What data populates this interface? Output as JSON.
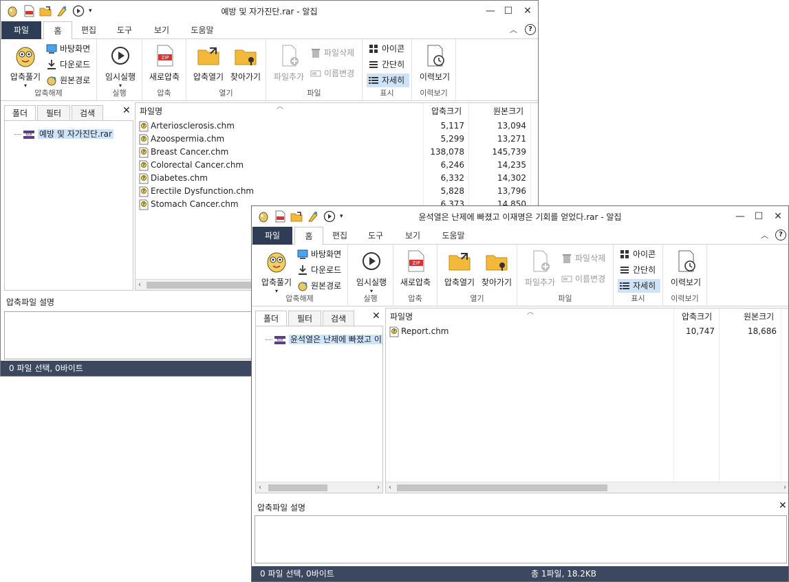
{
  "windows": [
    {
      "title": "예방 및 자가진단.rar - 알집",
      "tabs": [
        "파일",
        "홈",
        "편집",
        "도구",
        "보기",
        "도움말"
      ],
      "ribbon": {
        "extract_big": "압축풀기",
        "desktop": "바탕화면",
        "download": "다운로드",
        "original_path": "원본경로",
        "group_extract": "압축해제",
        "run_temp": "임시실행",
        "group_run": "실행",
        "new_archive": "새로압축",
        "group_compress": "압축",
        "open_archive": "압축열기",
        "find": "찾아가기",
        "group_open": "열기",
        "add_file": "파일추가",
        "delete_file": "파일삭제",
        "rename": "이름변경",
        "group_file": "파일",
        "icon_view": "아이콘",
        "simple_view": "간단히",
        "detail_view": "자세히",
        "group_view": "표시",
        "history": "이력보기",
        "group_history": "이력보기"
      },
      "pane_tabs": [
        "폴더",
        "필터",
        "검색"
      ],
      "tree_node": "예방 및 자가진단.rar",
      "columns": {
        "name": "파일명",
        "compressed": "압축크기",
        "original": "원본크기"
      },
      "files": [
        {
          "name": "Arteriosclerosis.chm",
          "compressed": "5,117",
          "original": "13,094"
        },
        {
          "name": "Azoospermia.chm",
          "compressed": "5,299",
          "original": "13,271"
        },
        {
          "name": "Breast Cancer.chm",
          "compressed": "138,078",
          "original": "145,739"
        },
        {
          "name": "Colorectal Cancer.chm",
          "compressed": "6,246",
          "original": "14,235"
        },
        {
          "name": "Diabetes.chm",
          "compressed": "6,332",
          "original": "14,302"
        },
        {
          "name": "Erectile Dysfunction.chm",
          "compressed": "5,828",
          "original": "13,796"
        },
        {
          "name": "Stomach Cancer.chm",
          "compressed": "6,373",
          "original": "14,850"
        }
      ],
      "desc_label": "압축파일 설명",
      "status_left": "0 파일 선택,  0바이트",
      "status_right": ""
    },
    {
      "title": "윤석열은 난제에 빠졌고 이재명은 기회를 얻었다.rar - 알집",
      "tabs": [
        "파일",
        "홈",
        "편집",
        "도구",
        "보기",
        "도움말"
      ],
      "ribbon": {
        "extract_big": "압축풀기",
        "desktop": "바탕화면",
        "download": "다운로드",
        "original_path": "원본경로",
        "group_extract": "압축해제",
        "run_temp": "임시실행",
        "group_run": "실행",
        "new_archive": "새로압축",
        "group_compress": "압축",
        "open_archive": "압축열기",
        "find": "찾아가기",
        "group_open": "열기",
        "add_file": "파일추가",
        "delete_file": "파일삭제",
        "rename": "이름변경",
        "group_file": "파일",
        "icon_view": "아이콘",
        "simple_view": "간단히",
        "detail_view": "자세히",
        "group_view": "표시",
        "history": "이력보기",
        "group_history": "이력보기"
      },
      "pane_tabs": [
        "폴더",
        "필터",
        "검색"
      ],
      "tree_node": "윤석열은 난제에 빠졌고 이",
      "columns": {
        "name": "파일명",
        "compressed": "압축크기",
        "original": "원본크기"
      },
      "files": [
        {
          "name": "Report.chm",
          "compressed": "10,747",
          "original": "18,686"
        }
      ],
      "desc_label": "압축파일 설명",
      "status_left": "0 파일 선택,  0바이트",
      "status_right": "총 1파일,  18.2KB"
    }
  ],
  "colors": {
    "file_tab": "#2f3c55",
    "status_bar": "#3c4760",
    "selection": "#cde4fb"
  }
}
